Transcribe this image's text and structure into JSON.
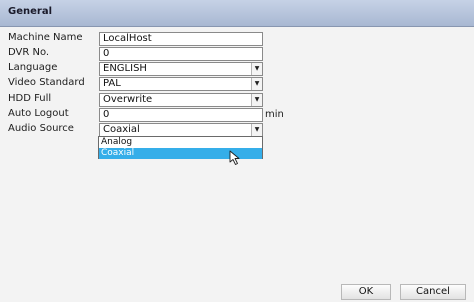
{
  "window": {
    "title": "General"
  },
  "form": {
    "machine_name": {
      "label": "Machine Name",
      "value": "LocalHost"
    },
    "dvr_no": {
      "label": "DVR No.",
      "value": "0"
    },
    "language": {
      "label": "Language",
      "value": "ENGLISH"
    },
    "video_standard": {
      "label": "Video Standard",
      "value": "PAL"
    },
    "hdd_full": {
      "label": "HDD Full",
      "value": "Overwrite"
    },
    "auto_logout": {
      "label": "Auto Logout",
      "value": "0",
      "unit": "min"
    },
    "audio_source": {
      "label": "Audio Source",
      "value": "Coaxial",
      "options": [
        "Analog",
        "Coaxial"
      ],
      "highlighted": "Coaxial"
    }
  },
  "buttons": {
    "ok": "OK",
    "cancel": "Cancel"
  },
  "icons": {
    "dropdown": "chevron-down-icon",
    "pointer": "mouse-pointer-icon"
  },
  "colors": {
    "title_bar": "#b4c2dc",
    "highlight": "#35aee9",
    "background": "#f1f1f1"
  }
}
